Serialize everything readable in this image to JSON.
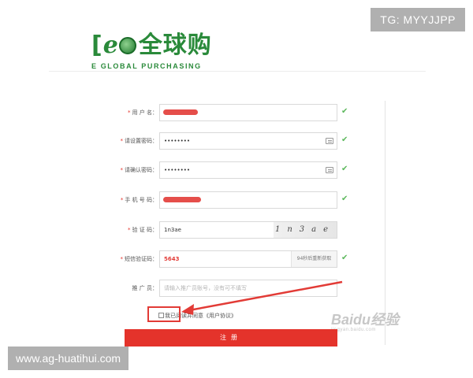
{
  "logo": {
    "bracket": "[",
    "letter": "e",
    "cn_name": "全球购",
    "sub": "E GLOBAL PURCHASING"
  },
  "form": {
    "username": {
      "label": "用 户 名：",
      "valid": "✔"
    },
    "set_password": {
      "label": "请设置密码：",
      "value": "••••••••",
      "valid": "✔"
    },
    "confirm_password": {
      "label": "请确认密码：",
      "value": "••••••••",
      "valid": "✔"
    },
    "phone": {
      "label": "手 机 号 码：",
      "valid": "✔"
    },
    "captcha": {
      "label": "验 证 码：",
      "value": "1n3ae",
      "image_text": "1n3ae"
    },
    "sms_code": {
      "label": "短信验证码：",
      "value": "5643",
      "button": "94秒后重新获取",
      "valid": "✔"
    },
    "referrer": {
      "label": "推 广 员：",
      "placeholder": "请输入推广员账号，没有可不填写"
    }
  },
  "agreement": {
    "text": "我已阅读并同意《用户协议》"
  },
  "register_button": {
    "label": "注册"
  },
  "watermarks": {
    "baidu_main": "Baidu经验",
    "baidu_sub": "jingyan.baidu.com",
    "top_right": "TG: MYYJJPP",
    "bottom_left": "www.ag-huatihui.com"
  },
  "colors": {
    "brand_green": "#2a8a3a",
    "accent_red": "#e4332b",
    "valid_green": "#5cb85c"
  }
}
